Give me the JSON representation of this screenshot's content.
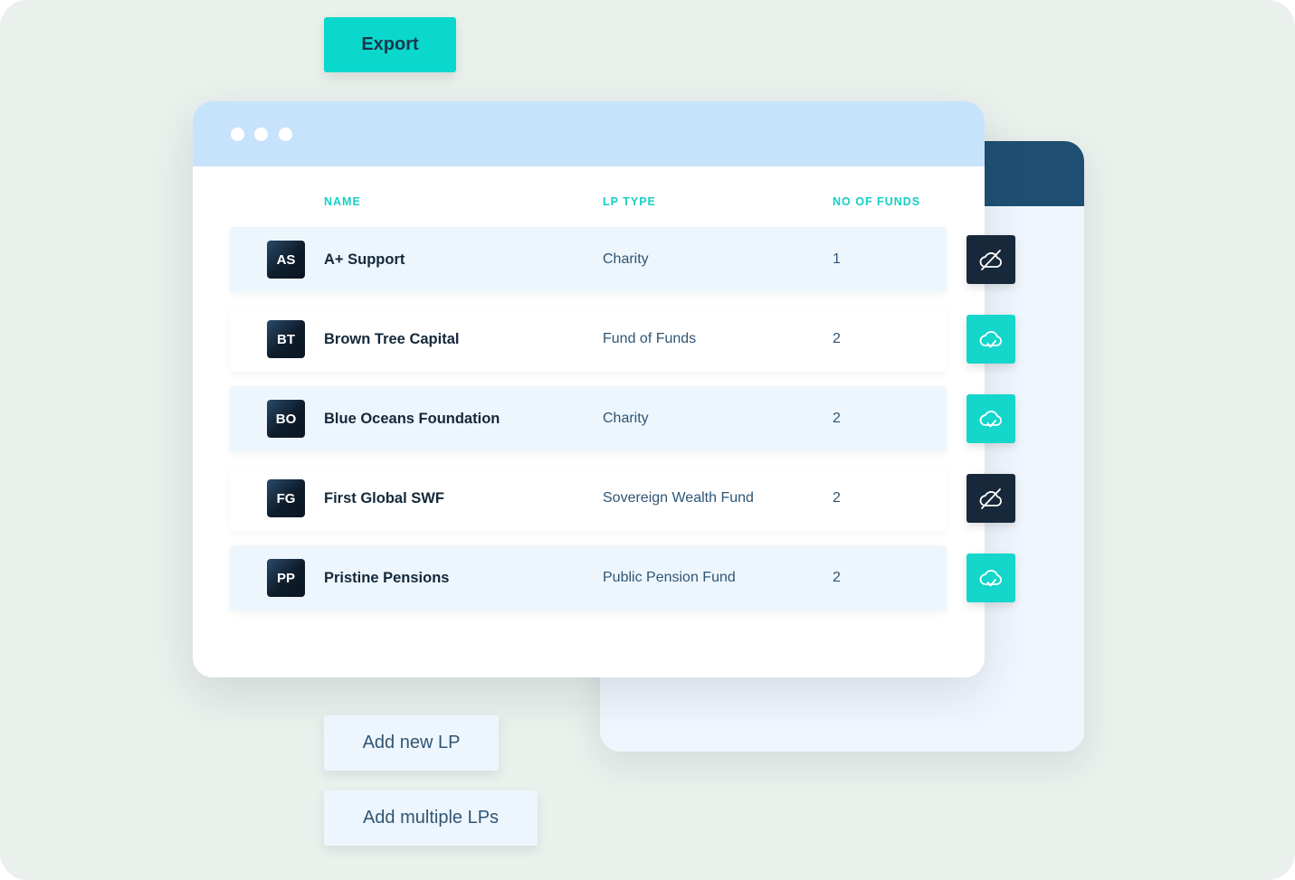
{
  "toolbar": {
    "export_label": "Export"
  },
  "table": {
    "headers": {
      "name": "NAME",
      "lp_type": "LP TYPE",
      "funds": "NO OF FUNDS"
    },
    "rows": [
      {
        "initials": "AS",
        "name": "A+ Support",
        "lp_type": "Charity",
        "funds": "1",
        "sync_status": "unsynced"
      },
      {
        "initials": "BT",
        "name": "Brown Tree Capital",
        "lp_type": "Fund of Funds",
        "funds": "2",
        "sync_status": "synced"
      },
      {
        "initials": "BO",
        "name": "Blue Oceans Foundation",
        "lp_type": "Charity",
        "funds": "2",
        "sync_status": "synced"
      },
      {
        "initials": "FG",
        "name": "First Global SWF",
        "lp_type": "Sovereign Wealth Fund",
        "funds": "2",
        "sync_status": "unsynced"
      },
      {
        "initials": "PP",
        "name": "Pristine Pensions",
        "lp_type": "Public Pension Fund",
        "funds": "2",
        "sync_status": "synced"
      }
    ]
  },
  "actions": {
    "add_new_label": "Add new LP",
    "add_multiple_label": "Add multiple LPs"
  },
  "icons": {
    "synced": "cloud-check-icon",
    "unsynced": "cloud-off-icon"
  },
  "colors": {
    "accent": "#0ad8cc",
    "header_bar": "#c7e3fb",
    "back_header": "#1e4f72",
    "dark": "#17283a",
    "row_shade": "#eef6fd",
    "page_bg": "#eaf0ec"
  }
}
